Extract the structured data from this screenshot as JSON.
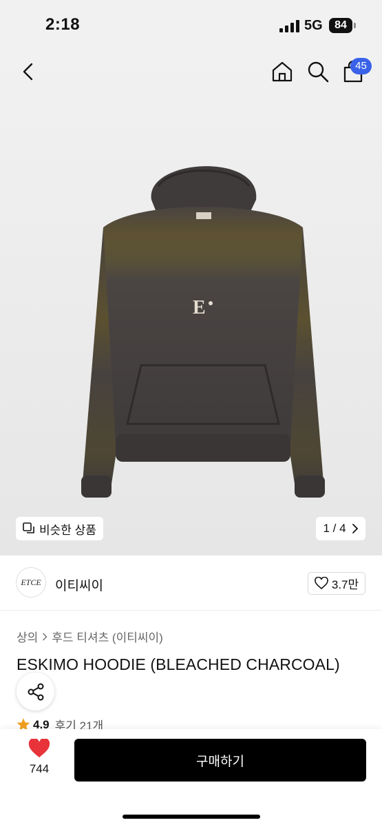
{
  "status_bar": {
    "time": "2:18",
    "network": "5G",
    "battery": "84"
  },
  "nav": {
    "cart_count": "45"
  },
  "gallery": {
    "similar_label": "비슷한 상품",
    "pager": "1 / 4"
  },
  "brand": {
    "logo_text": "ETCE",
    "name": "이티씨이",
    "likes": "3.7만"
  },
  "product": {
    "breadcrumb": [
      "상의",
      "후드 티셔츠 (이티씨이)"
    ],
    "title": "ESKIMO HOODIE (BLEACHED CHARCOAL)",
    "rating": "4.9",
    "reviews": "후기 21개"
  },
  "bottom_bar": {
    "wish_count": "744",
    "buy_label": "구매하기"
  },
  "colors": {
    "accent_badge": "#3a62e8",
    "heart": "#e8333a",
    "star": "#f0a020",
    "buy_button": "#000000"
  }
}
